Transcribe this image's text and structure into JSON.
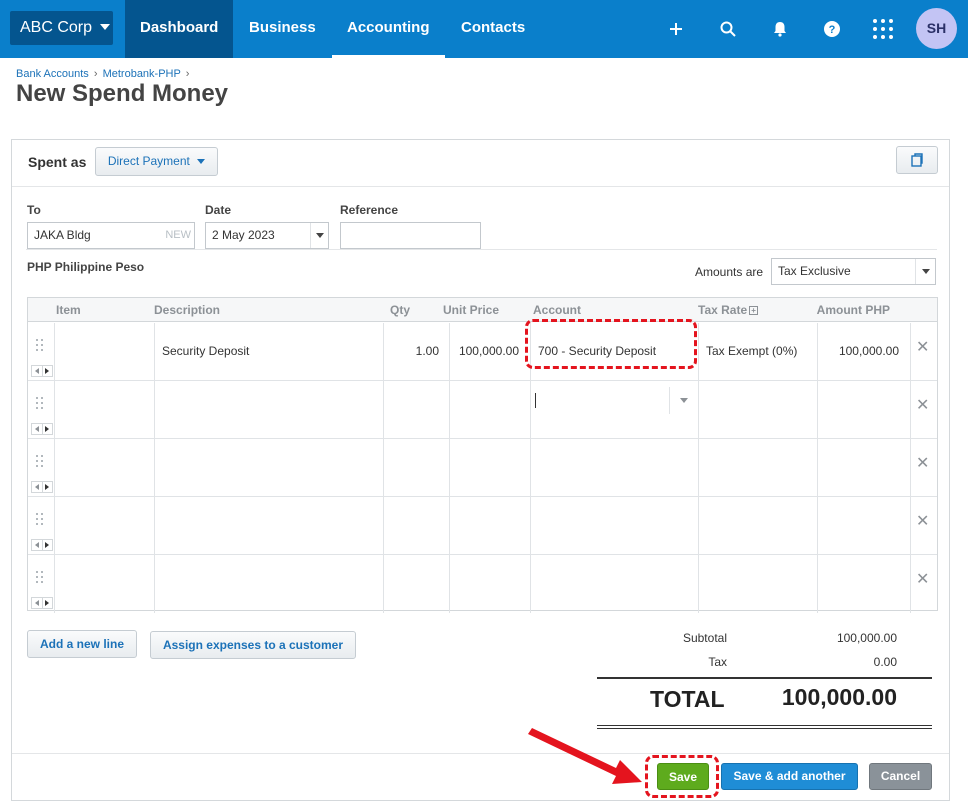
{
  "nav": {
    "org_name": "ABC Corp",
    "tabs": [
      "Dashboard",
      "Business",
      "Accounting",
      "Contacts"
    ],
    "avatar_initials": "SH",
    "colors": {
      "bar": "#0a7fcb",
      "active": "#04558f"
    }
  },
  "breadcrumb": {
    "bank_accounts": "Bank Accounts",
    "account": "Metrobank-PHP",
    "separator": "›"
  },
  "page_title": "New Spend Money",
  "spent_as": {
    "label": "Spent as",
    "value": "Direct Payment"
  },
  "form": {
    "to_label": "To",
    "to_value": "JAKA Bldg",
    "new_tag": "NEW",
    "date_label": "Date",
    "date_value": "2 May 2023",
    "reference_label": "Reference",
    "reference_value": ""
  },
  "currency": "PHP Philippine Peso",
  "amounts_are": {
    "label": "Amounts are",
    "value": "Tax Exclusive"
  },
  "grid": {
    "headers": {
      "item": "Item",
      "description": "Description",
      "qty": "Qty",
      "unit_price": "Unit Price",
      "account": "Account",
      "tax_rate": "Tax Rate",
      "amount": "Amount PHP"
    },
    "rows": [
      {
        "item": "",
        "description": "Security Deposit",
        "qty": "1.00",
        "unit_price": "100,000.00",
        "account": "700 - Security Deposit",
        "tax_rate": "Tax Exempt (0%)",
        "amount": "100,000.00"
      },
      {
        "item": "",
        "description": "",
        "qty": "",
        "unit_price": "",
        "account": "",
        "tax_rate": "",
        "amount": ""
      },
      {
        "item": "",
        "description": "",
        "qty": "",
        "unit_price": "",
        "account": "",
        "tax_rate": "",
        "amount": ""
      },
      {
        "item": "",
        "description": "",
        "qty": "",
        "unit_price": "",
        "account": "",
        "tax_rate": "",
        "amount": ""
      },
      {
        "item": "",
        "description": "",
        "qty": "",
        "unit_price": "",
        "account": "",
        "tax_rate": "",
        "amount": ""
      }
    ]
  },
  "actions": {
    "add_line": "Add a new line",
    "assign_expenses": "Assign expenses to a customer"
  },
  "totals": {
    "subtotal_label": "Subtotal",
    "subtotal": "100,000.00",
    "tax_label": "Tax",
    "tax": "0.00",
    "total_label": "TOTAL",
    "total": "100,000.00"
  },
  "buttons": {
    "save": "Save",
    "save_add": "Save & add another",
    "cancel": "Cancel"
  },
  "annotation_color": "#e4141e"
}
